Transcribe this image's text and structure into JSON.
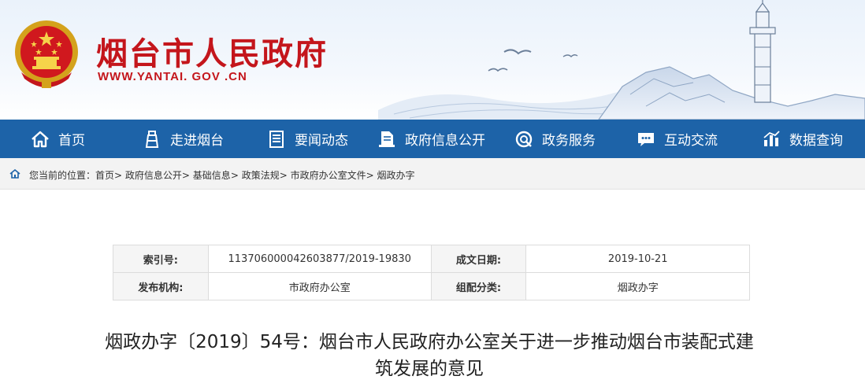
{
  "header": {
    "title": "烟台市人民政府",
    "url": "WWW.YANTAI. GOV .CN"
  },
  "nav": {
    "items": [
      {
        "label": "首页",
        "icon": "home-icon"
      },
      {
        "label": "走进烟台",
        "icon": "lighthouse-icon"
      },
      {
        "label": "要闻动态",
        "icon": "news-icon"
      },
      {
        "label": "政府信息公开",
        "icon": "document-icon"
      },
      {
        "label": "政务服务",
        "icon": "service-icon"
      },
      {
        "label": "互动交流",
        "icon": "chat-icon"
      },
      {
        "label": "数据查询",
        "icon": "chart-icon"
      }
    ],
    "background": "#1d63a8"
  },
  "breadcrumb": {
    "prefix": "您当前的位置：",
    "items": [
      "首页",
      "政府信息公开",
      "基础信息",
      "政策法规",
      "市政府办公室文件",
      "烟政办字"
    ]
  },
  "info": {
    "index_label": "索引号:",
    "index_value": "113706000042603877/2019-19830",
    "date_label": "成文日期:",
    "date_value": "2019-10-21",
    "issuer_label": "发布机构:",
    "issuer_value": "市政府办公室",
    "category_label": "组配分类:",
    "category_value": "烟政办字"
  },
  "document": {
    "title_line1": "烟政办字〔2019〕54号：烟台市人民政府办公室关于进一步推动烟台市装配式建",
    "title_line2": "筑发展的意见"
  },
  "colors": {
    "brand_red": "#c4161c",
    "nav_blue": "#1d63a8"
  }
}
